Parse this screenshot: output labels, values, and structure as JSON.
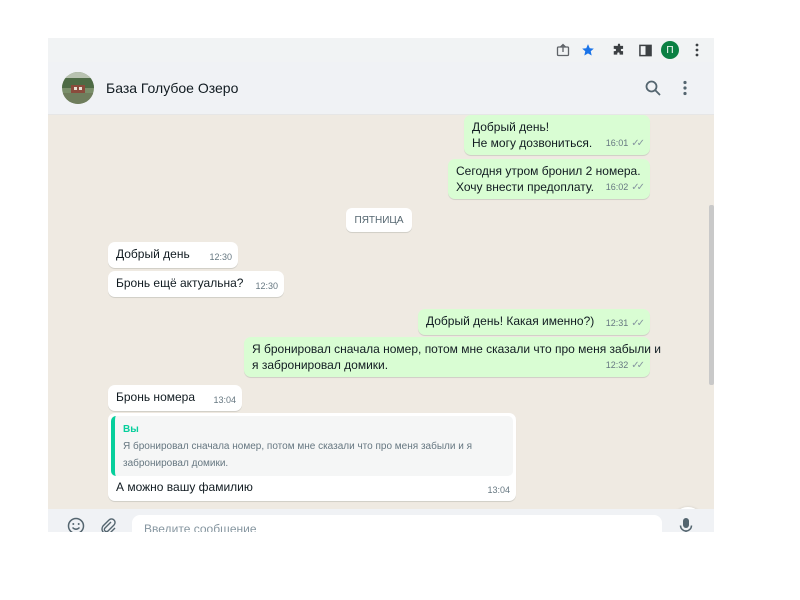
{
  "browser": {
    "profile_initial": "П",
    "icons": [
      "share-icon",
      "star-icon",
      "extensions-icon",
      "sidepanel-icon",
      "more-vert-icon"
    ],
    "accent": "#1a73e8",
    "profile_color": "#0b8043"
  },
  "header": {
    "contact_name": "База Голубое Озеро",
    "icons": [
      "search-icon",
      "menu-icon"
    ]
  },
  "day_divider": "ПЯТНИЦА",
  "messages": [
    {
      "dir": "out",
      "lines": "Добрый день!\nНе могу дозвониться.",
      "time": "16:01",
      "read": true
    },
    {
      "dir": "out",
      "lines": "Сегодня утром бронил 2 номера.\nХочу внести предоплату.",
      "time": "16:02",
      "read": true
    },
    {
      "dir": "in",
      "lines": "Добрый день",
      "time": "12:30"
    },
    {
      "dir": "in",
      "lines": "Бронь ещё актуальна?",
      "time": "12:30"
    },
    {
      "dir": "out",
      "lines": "Добрый день! Какая именно?)",
      "time": "12:31",
      "read": true
    },
    {
      "dir": "out",
      "lines": "Я бронировал сначала номер, потом мне сказали что про меня забыли и\nя забронировал домики.",
      "time": "12:32",
      "read": true
    },
    {
      "dir": "in",
      "lines": "Бронь номера",
      "time": "13:04"
    },
    {
      "dir": "in",
      "lines": "А можно вашу фамилию",
      "time": "13:04",
      "quote": {
        "author": "Вы",
        "text": "Я бронировал сначала номер, потом мне сказали что про меня забыли и я\nзабронировал домики."
      }
    }
  ],
  "composer": {
    "placeholder": "Введите сообщение",
    "value": "",
    "icons": [
      "emoji-icon",
      "attach-icon",
      "mic-icon"
    ]
  },
  "colors": {
    "chat_bg": "#efeae2",
    "outgoing_bubble": "#d9fdd3",
    "incoming_bubble": "#ffffff",
    "quote_accent": "#06cf9c"
  }
}
